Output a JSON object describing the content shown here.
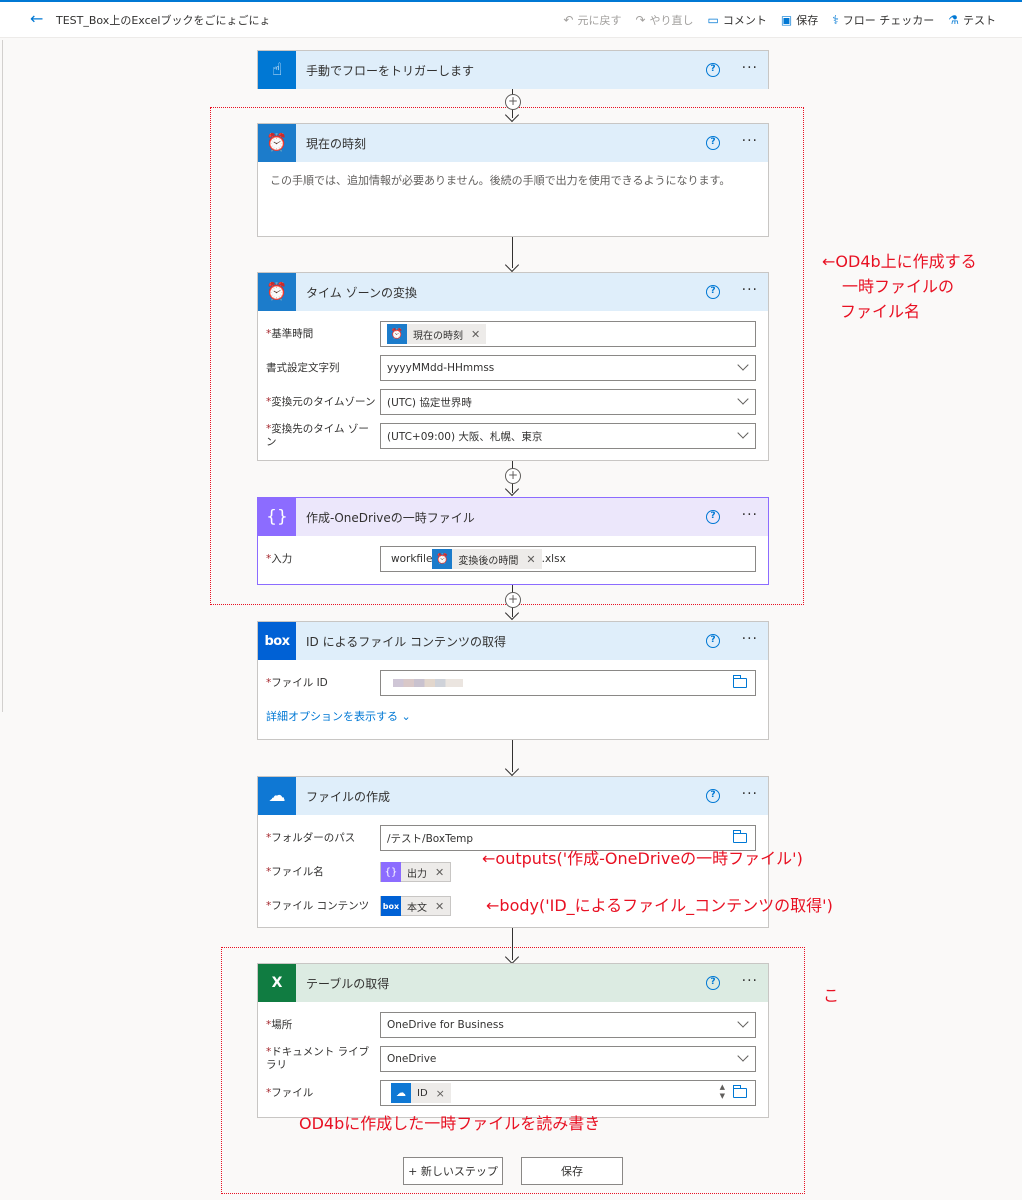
{
  "header": {
    "title": "TEST_Box上のExcelブックをごにょごにょ",
    "commands": [
      {
        "icon": "undo-icon",
        "glyph": "↶",
        "label": "元に戻す",
        "enabled": false
      },
      {
        "icon": "redo-icon",
        "glyph": "↷",
        "label": "やり直し",
        "enabled": false
      },
      {
        "icon": "comment-icon",
        "glyph": "▭",
        "label": "コメント",
        "enabled": true
      },
      {
        "icon": "save-icon",
        "glyph": "▣",
        "label": "保存",
        "enabled": true
      },
      {
        "icon": "stethoscope-icon",
        "glyph": "⚕",
        "label": "フロー チェッカー",
        "enabled": true
      },
      {
        "icon": "flask-icon",
        "glyph": "⚗",
        "label": "テスト",
        "enabled": true
      }
    ]
  },
  "colors": {
    "trigger": "#0078d4",
    "schedule": "#1c7ccb",
    "compose": "#8c6cff",
    "box": "#0061d5",
    "onedrive": "#0f78d4",
    "excel": "#107c41",
    "annotation": "#e81123"
  },
  "steps": {
    "trigger": {
      "title": "手動でフローをトリガーします",
      "icon": "touch-icon"
    },
    "current_time": {
      "title": "現在の時刻",
      "icon": "alarm-clock-icon",
      "description": "この手順では、追加情報が必要ありません。後続の手順で出力を使用できるようになります。"
    },
    "convert_tz": {
      "title": "タイム ゾーンの変換",
      "icon": "alarm-clock-icon",
      "fields": {
        "base_time_label": "基準時間",
        "base_time_token": "現在の時刻",
        "format_label": "書式設定文字列",
        "format_value": "yyyyMMdd-HHmmss",
        "source_tz_label": "変換元のタイムゾーン",
        "source_tz_value": "(UTC) 協定世界時",
        "dest_tz_label": "変換先のタイム ゾーン",
        "dest_tz_value": "(UTC+09:00) 大阪、札幌、東京"
      }
    },
    "compose": {
      "title": "作成-OneDriveの一時ファイル",
      "icon": "braces-icon",
      "input_label": "入力",
      "input_prefix": "workfile",
      "input_token": "変換後の時間",
      "input_suffix": ".xlsx"
    },
    "box_get": {
      "title": "ID によるファイル コンテンツの取得",
      "icon": "box-logo-icon",
      "file_id_label": "ファイル ID",
      "advanced_link": "詳細オプションを表示する"
    },
    "create_file": {
      "title": "ファイルの作成",
      "icon": "cloud-icon",
      "folder_label": "フォルダーのパス",
      "folder_value": "/テスト/BoxTemp",
      "name_label": "ファイル名",
      "name_token": "出力",
      "content_label": "ファイル コンテンツ",
      "content_token": "本文"
    },
    "get_tables": {
      "title": "テーブルの取得",
      "icon": "excel-icon",
      "location_label": "場所",
      "location_value": "OneDrive for Business",
      "library_label": "ドキュメント ライブラリ",
      "library_value": "OneDrive",
      "file_label": "ファイル",
      "file_token": "ID"
    }
  },
  "buttons": {
    "new_step": "+ 新しいステップ",
    "save": "保存"
  },
  "annotations": {
    "od4b_line1": "←OD4b上に作成する",
    "od4b_line2": "一時ファイルの",
    "od4b_line3": "ファイル名",
    "outputs": "←outputs('作成-OneDriveの一時ファイル')",
    "body": "←body('ID_によるファイル_コンテンツの取得')",
    "ko": "こ",
    "readwrite": "OD4bに作成した一時ファイルを読み書き"
  }
}
